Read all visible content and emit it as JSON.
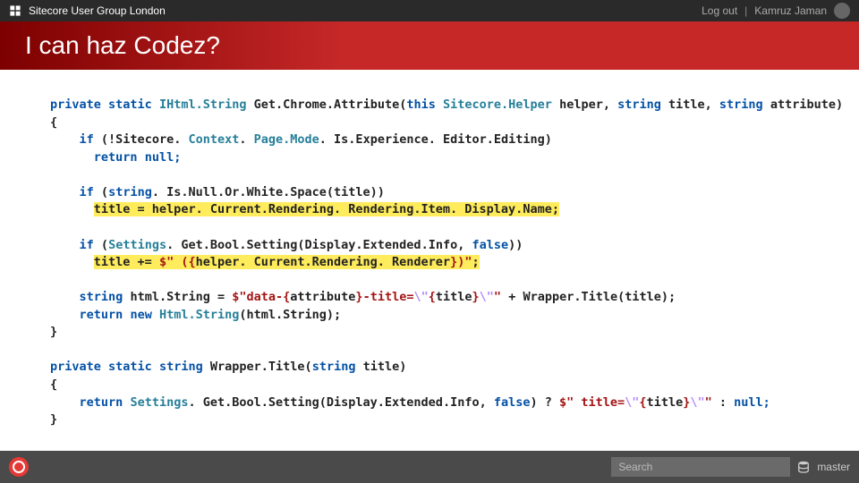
{
  "topbar": {
    "title": "Sitecore User Group London",
    "logout": "Log out",
    "username": "Kamruz Jaman"
  },
  "hero": {
    "title": "I can haz Codez?"
  },
  "code": {
    "m1_sig_1": "private",
    "m1_sig_2": "static",
    "m1_sig_3": "IHtml.String",
    "m1_sig_4": "Get.Chrome.Attribute(",
    "m1_sig_5": "this",
    "m1_sig_6": "Sitecore.Helper",
    "m1_sig_7": "helper, ",
    "m1_sig_8": "string",
    "m1_sig_9": "title, ",
    "m1_sig_10": "string",
    "m1_sig_11": "attribute)",
    "brace_open": "{",
    "if1_1": "if",
    "if1_2": "(!Sitecore. ",
    "if1_3": "Context",
    "if1_4": ". ",
    "if1_5": "Page.Mode",
    "if1_6": ". Is.Experience. Editor.Editing)",
    "ret_null_1": "return",
    "ret_null_2": "null;",
    "if2_1": "if",
    "if2_2": "(",
    "if2_3": "string",
    "if2_4": ". Is.Null.Or.White.Space(title))",
    "assign1": "title = helper. Current.Rendering. Rendering.Item. Display.Name;",
    "if3_1": "if",
    "if3_2": "(",
    "if3_3": "Settings",
    "if3_4": ". Get.Bool.Setting(Display.Extended.Info, ",
    "if3_5": "false",
    "if3_6": "))",
    "assign2_1": "title += ",
    "assign2_2": "$\" ({",
    "assign2_3": "helper. Current.Rendering. Renderer",
    "assign2_4": "})\"",
    "assign2_5": ";",
    "decl_1": "string",
    "decl_2": "html.String = ",
    "decl_3": "$\"data-{",
    "decl_4": "attribute",
    "decl_5": "}",
    "decl_6": "-title=",
    "decl_7": "\\\"",
    "decl_8": "{",
    "decl_9": "title",
    "decl_10": "}",
    "decl_11": "\\\"",
    "decl_12": "\"",
    "decl_13": " + Wrapper.Title(title);",
    "ret2_1": "return",
    "ret2_2": "new",
    "ret2_3": "Html.String",
    "ret2_4": "(html.String);",
    "brace_close": "}",
    "m2_sig_1": "private",
    "m2_sig_2": "static",
    "m2_sig_3": "string",
    "m2_sig_4": "Wrapper.Title(",
    "m2_sig_5": "string",
    "m2_sig_6": "title)",
    "m2_ret_1": "return",
    "m2_ret_2": "Settings",
    "m2_ret_3": ". Get.Bool.Setting(Display.Extended.Info, ",
    "m2_ret_4": "false",
    "m2_ret_5": ") ? ",
    "m2_ret_6": "$\" title=",
    "m2_ret_7": "\\\"",
    "m2_ret_8": "{",
    "m2_ret_9": "title",
    "m2_ret_10": "}",
    "m2_ret_11": "\\\"",
    "m2_ret_12": "\"",
    "m2_ret_13": " : ",
    "m2_ret_14": "null;"
  },
  "footer": {
    "search_placeholder": "Search",
    "db_label": "master"
  }
}
